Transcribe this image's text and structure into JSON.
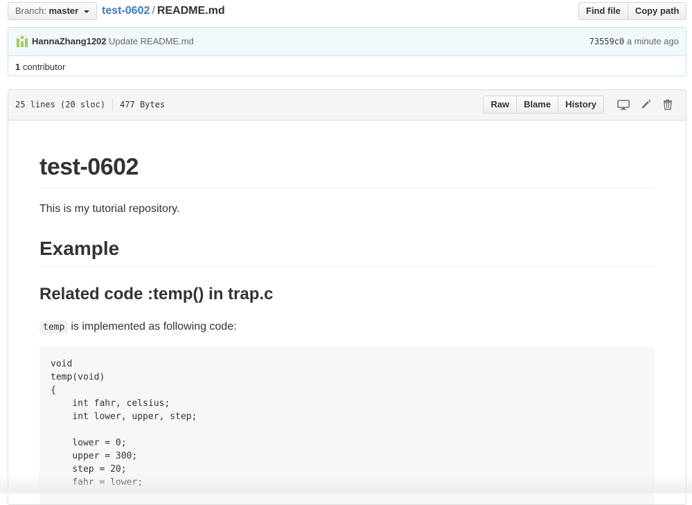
{
  "topbar": {
    "branch_label": "Branch:",
    "branch_value": "master",
    "repo": "test-0602",
    "separator": "/",
    "file": "README.md",
    "find_file": "Find file",
    "copy_path": "Copy path"
  },
  "commit": {
    "author": "HannaZhang1202",
    "message": "Update README.md",
    "sha": "73559c0",
    "time": "a minute ago",
    "contributors_count": "1",
    "contributors_label": "contributor"
  },
  "file_header": {
    "lines": "25 lines (20 sloc)",
    "size": "477 Bytes",
    "raw": "Raw",
    "blame": "Blame",
    "history": "History"
  },
  "readme": {
    "h1": "test-0602",
    "p1": "This is my tutorial repository.",
    "h2": "Example",
    "h3": "Related code :temp() in trap.c",
    "inline_code": "temp",
    "p2_rest": "is implemented as following code:",
    "code": "void\ntemp(void)\n{\n    int fahr, celsius;\n    int lower, upper, step;\n\n    lower = 0;\n    upper = 300;\n    step = 20;\n    fahr = lower;"
  },
  "colors": {
    "link": "#4078c0",
    "commit_bg": "#f2f9fc",
    "avatar": "#8cc63e"
  },
  "icons": [
    "caret-down-icon",
    "avatar-icon",
    "desktop-icon",
    "pencil-icon",
    "trash-icon"
  ]
}
